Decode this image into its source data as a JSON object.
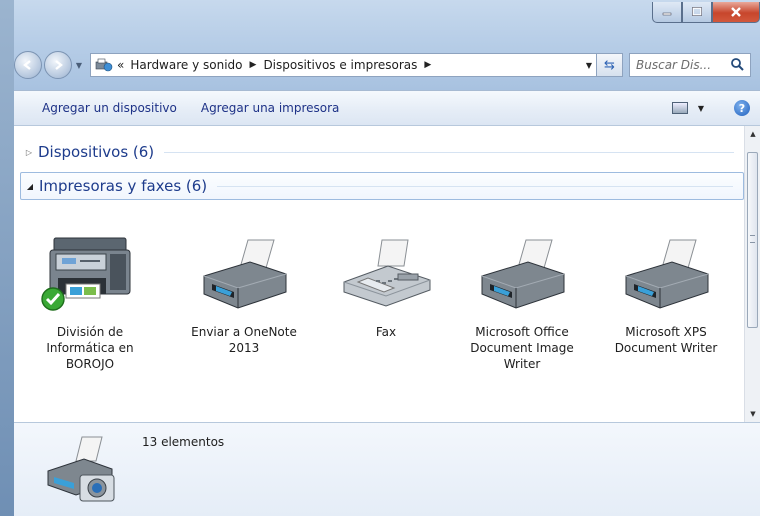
{
  "window": {
    "caption_buttons": [
      "minimize-icon",
      "maximize-icon",
      "close-icon"
    ]
  },
  "navigation": {
    "breadcrumb_overflow": "«",
    "breadcrumb": [
      "Hardware y sonido",
      "Dispositivos e impresoras"
    ],
    "search_placeholder": "Buscar Dis..."
  },
  "toolbar": {
    "add_device": "Agregar un dispositivo",
    "add_printer": "Agregar una impresora"
  },
  "groups": {
    "devices": {
      "title": "Dispositivos (6)",
      "expanded": false
    },
    "printers": {
      "title": "Impresoras y faxes (6)",
      "expanded": true
    }
  },
  "printers": [
    {
      "label": "División de Informática en BOROJO",
      "icon": "multifunction-printer-icon",
      "default": true
    },
    {
      "label": "Enviar a OneNote 2013",
      "icon": "printer-icon"
    },
    {
      "label": "Fax",
      "icon": "fax-icon"
    },
    {
      "label": "Microsoft Office Document Image Writer",
      "icon": "printer-icon"
    },
    {
      "label": "Microsoft XPS Document Writer",
      "icon": "printer-icon"
    }
  ],
  "details": {
    "count_text": "13 elementos",
    "icon": "printer-camera-icon"
  },
  "colors": {
    "link_text": "#1e3287",
    "group_title": "#1e3c8c",
    "default_check": "#3aa935"
  }
}
